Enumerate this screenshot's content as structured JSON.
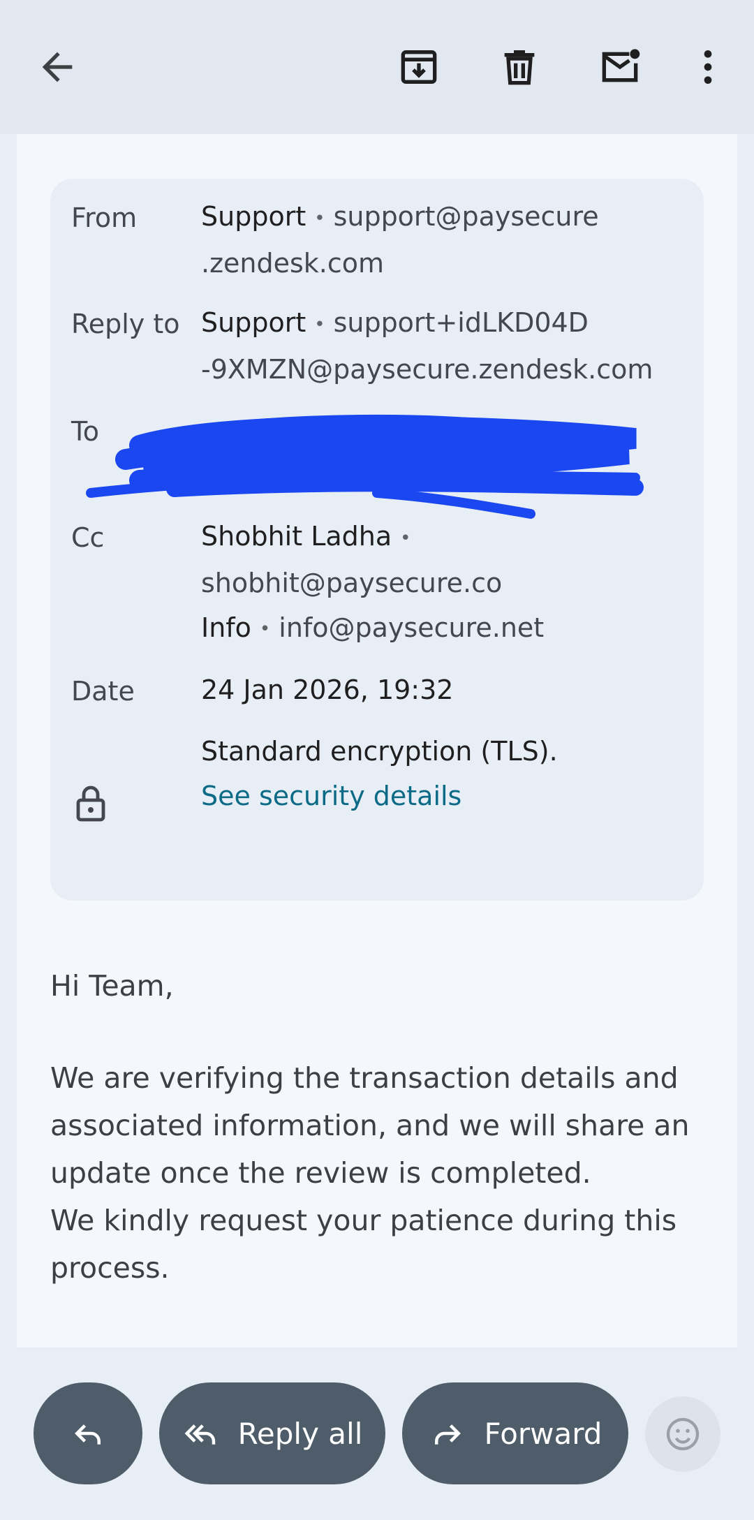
{
  "toolbar": {
    "back_icon": "arrow-left-icon",
    "archive_icon": "archive-icon",
    "delete_icon": "trash-icon",
    "mark_unread_icon": "mail-unread-icon",
    "more_icon": "more-vert-icon"
  },
  "details": {
    "from_label": "From",
    "from_name": "Support",
    "from_email_line1": "support@paysecure",
    "from_email_line2": ".zendesk.com",
    "reply_label": "Reply to",
    "reply_name": "Support",
    "reply_email_line1": "support+idLKD04D",
    "reply_email_line2": "-9XMZN@paysecure.zendesk.com",
    "to_label": "To",
    "cc_label": "Cc",
    "cc1_name": "Shobhit Ladha",
    "cc1_email": "shobhit@paysecure.co",
    "cc2_name": "Info",
    "cc2_email": "info@paysecure.net",
    "date_label": "Date",
    "date_value": "24 Jan 2026, 19:32",
    "encryption_text": "Standard encryption (TLS).",
    "security_link": "See security details"
  },
  "body": {
    "greeting": "Hi Team,",
    "para1_line1": "We are verifying the transaction details and",
    "para1_line2": "associated information, and we will share an",
    "para1_line3": "update once the review is completed.",
    "para2_line1": "We kindly request your patience during this",
    "para2_line2": "process."
  },
  "actions": {
    "reply_all_label": "Reply all",
    "forward_label": "Forward"
  },
  "colors": {
    "accent_link": "#0b6a86",
    "pill": "#4e5d69",
    "redaction": "#1a47f0"
  }
}
